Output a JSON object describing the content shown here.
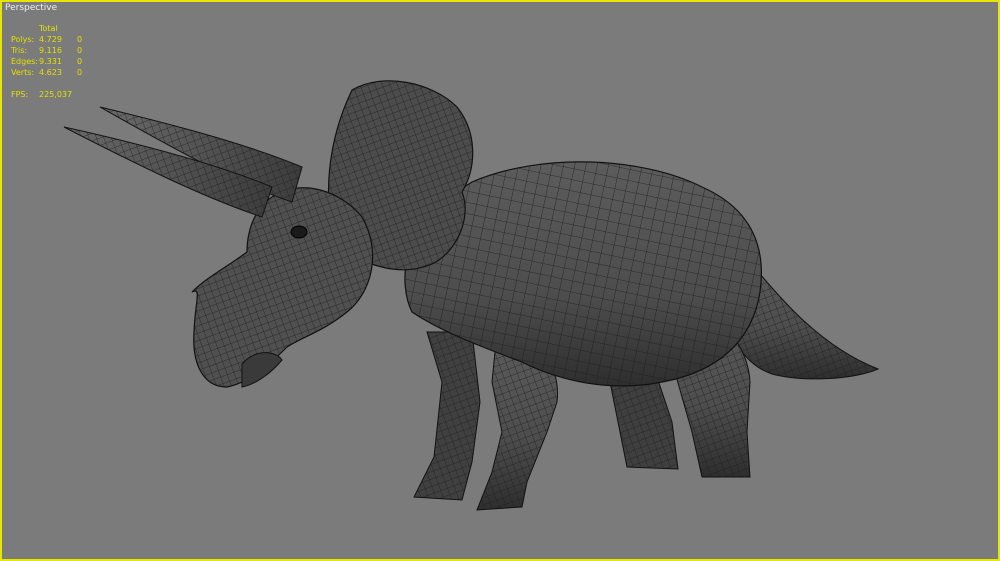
{
  "viewport": {
    "label": "Perspective",
    "border_color": "#e8e600",
    "background": "#7b7b7b",
    "model_icon": "triceratops-wireframe-mesh"
  },
  "stats": {
    "header": "Total",
    "rows": [
      {
        "label": "Polys:",
        "total": "4.729",
        "selected": "0"
      },
      {
        "label": "Tris:",
        "total": "9.116",
        "selected": "0"
      },
      {
        "label": "Edges:",
        "total": "9.331",
        "selected": "0"
      },
      {
        "label": "Verts:",
        "total": "4.623",
        "selected": "0"
      }
    ],
    "fps_label": "FPS:",
    "fps_value": "225,037",
    "text_color": "#e4e000"
  }
}
